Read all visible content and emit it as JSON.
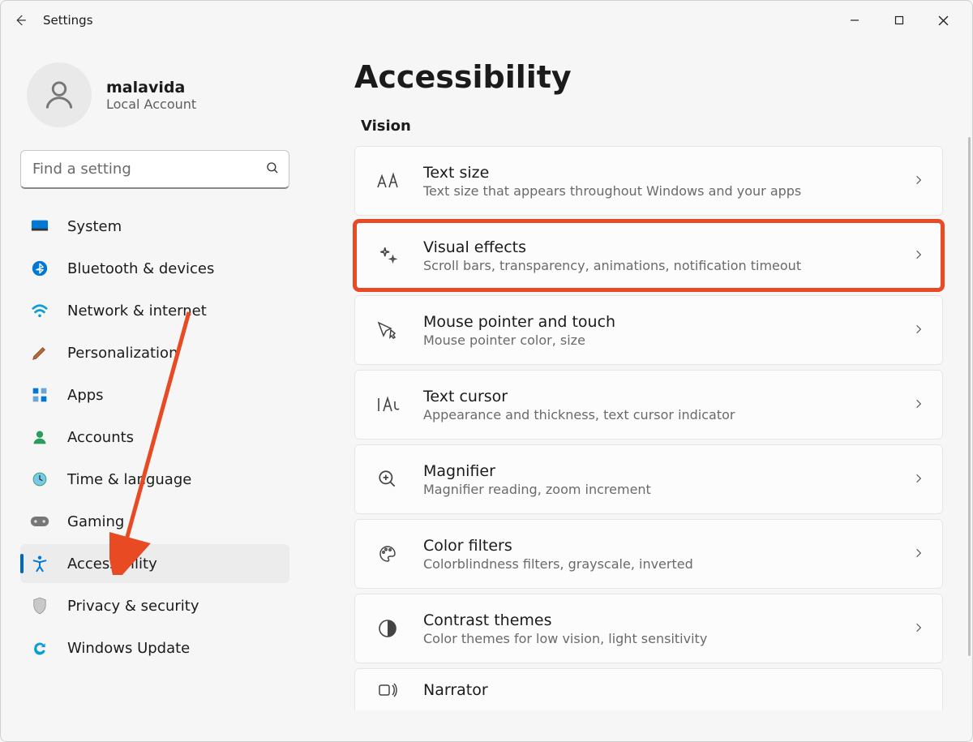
{
  "window": {
    "title": "Settings"
  },
  "account": {
    "name": "malavida",
    "type": "Local Account"
  },
  "search": {
    "placeholder": "Find a setting"
  },
  "nav": {
    "items": [
      {
        "key": "system",
        "label": "System"
      },
      {
        "key": "bluetooth",
        "label": "Bluetooth & devices"
      },
      {
        "key": "network",
        "label": "Network & internet"
      },
      {
        "key": "personalization",
        "label": "Personalization"
      },
      {
        "key": "apps",
        "label": "Apps"
      },
      {
        "key": "accounts",
        "label": "Accounts"
      },
      {
        "key": "time",
        "label": "Time & language"
      },
      {
        "key": "gaming",
        "label": "Gaming"
      },
      {
        "key": "accessibility",
        "label": "Accessibility"
      },
      {
        "key": "privacy",
        "label": "Privacy & security"
      },
      {
        "key": "update",
        "label": "Windows Update"
      }
    ],
    "selected": "accessibility"
  },
  "page": {
    "title": "Accessibility",
    "section": "Vision",
    "cards": [
      {
        "key": "text-size",
        "title": "Text size",
        "sub": "Text size that appears throughout Windows and your apps"
      },
      {
        "key": "visual-effects",
        "title": "Visual effects",
        "sub": "Scroll bars, transparency, animations, notification timeout",
        "highlight": true
      },
      {
        "key": "mouse-pointer",
        "title": "Mouse pointer and touch",
        "sub": "Mouse pointer color, size"
      },
      {
        "key": "text-cursor",
        "title": "Text cursor",
        "sub": "Appearance and thickness, text cursor indicator"
      },
      {
        "key": "magnifier",
        "title": "Magnifier",
        "sub": "Magnifier reading, zoom increment"
      },
      {
        "key": "color-filters",
        "title": "Color filters",
        "sub": "Colorblindness filters, grayscale, inverted"
      },
      {
        "key": "contrast",
        "title": "Contrast themes",
        "sub": "Color themes for low vision, light sensitivity"
      },
      {
        "key": "narrator",
        "title": "Narrator",
        "sub": ""
      }
    ]
  },
  "annotation": {
    "arrow_color": "#e84a24"
  }
}
